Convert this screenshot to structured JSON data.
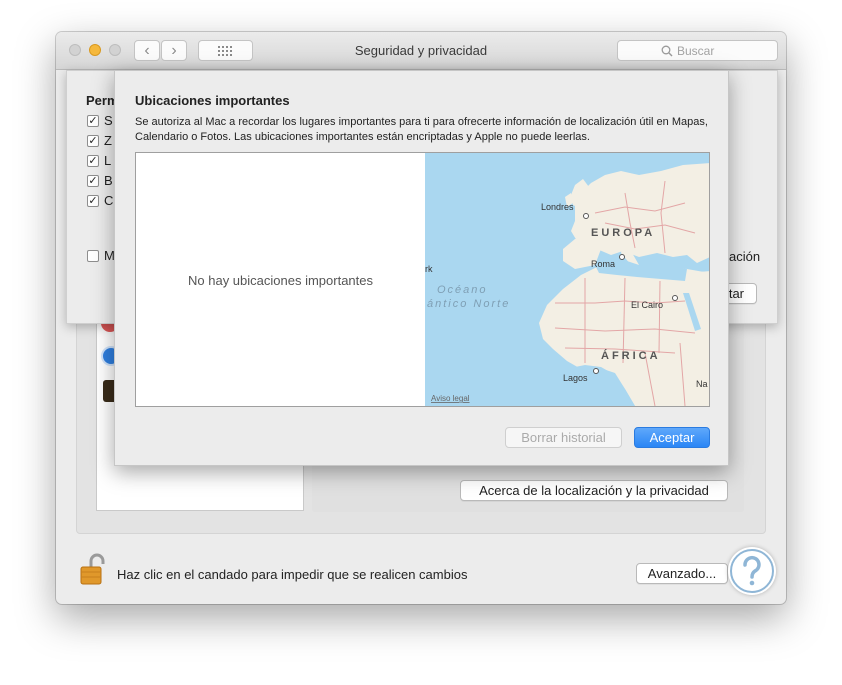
{
  "window": {
    "title": "Seguridad y privacidad",
    "search_placeholder": "Buscar"
  },
  "background_sheet": {
    "heading_partial": "Perm",
    "checkboxes": [
      {
        "label_partial": "S",
        "checked": true
      },
      {
        "label_partial": "Z",
        "checked": true
      },
      {
        "label_partial": "L",
        "checked": true
      },
      {
        "label_partial": "B",
        "checked": true
      },
      {
        "label_partial": "C",
        "checked": true
      }
    ],
    "unchecked_partial": "M",
    "right_text_partial": "ación",
    "right_button_partial": "tar"
  },
  "sheet": {
    "title": "Ubicaciones importantes",
    "description": "Se autoriza al Mac a recordar los lugares importantes para ti para ofrecerte información de localización útil en Mapas, Calendario o Fotos. Las ubicaciones importantes están encriptadas y Apple no puede leerlas.",
    "empty_message": "No hay ubicaciones importantes",
    "map_labels": {
      "europe": "EUROPA",
      "africa": "ÁFRICA",
      "ocean_line1": "Océano",
      "ocean_line2": "ántico Norte",
      "london": "Londres",
      "rome": "Roma",
      "cairo": "El Cairo",
      "lagos": "Lagos",
      "york_partial": "rk",
      "nairobi_partial": "Na",
      "legal": "Aviso legal"
    },
    "clear_history_button": "Borrar historial",
    "accept_button": "Aceptar"
  },
  "main": {
    "about_button": "Acerca de la localización y la privacidad",
    "lock_text": "Haz clic en el candado para impedir que se realicen cambios",
    "advanced_button": "Avanzado..."
  },
  "colors": {
    "accent": "#2a86f5",
    "water": "#aad7f0",
    "land": "#f3efe4",
    "border_lines": "#e3a6a6"
  }
}
